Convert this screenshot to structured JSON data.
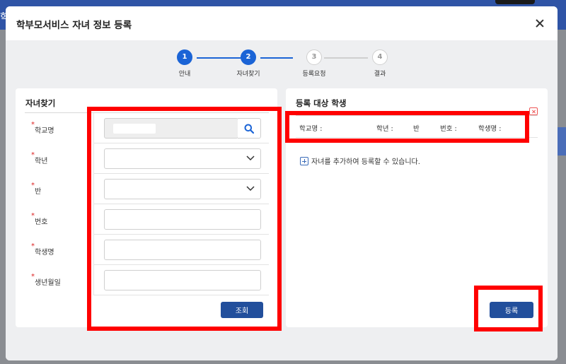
{
  "background": {
    "left_fragment": "학"
  },
  "modal": {
    "title": "학부모서비스 자녀 정보 등록",
    "close_icon": "close-icon"
  },
  "stepper": {
    "steps": [
      {
        "number": "1",
        "label": "안내",
        "active": true
      },
      {
        "number": "2",
        "label": "자녀찾기",
        "active": true
      },
      {
        "number": "3",
        "label": "등록요청",
        "active": false
      },
      {
        "number": "4",
        "label": "결과",
        "active": false
      }
    ]
  },
  "find_child": {
    "title": "자녀찾기",
    "fields": [
      {
        "label": "학교명",
        "value": "",
        "type": "search"
      },
      {
        "label": "학년",
        "value": "",
        "type": "select"
      },
      {
        "label": "반",
        "value": "",
        "type": "select"
      },
      {
        "label": "번호",
        "value": "",
        "type": "text"
      },
      {
        "label": "학생명",
        "value": "",
        "type": "text"
      },
      {
        "label": "생년월일",
        "value": "",
        "type": "text"
      }
    ],
    "required_mark": "*",
    "lookup_button": "조회"
  },
  "register_target": {
    "title": "등록 대상 학생",
    "columns": [
      "학교명 :",
      "학년 :",
      "반",
      "번호 :",
      "학생명 :"
    ],
    "add_hint": "자녀를 추가하여 등록할 수 있습니다.",
    "register_button": "등록"
  },
  "colors": {
    "primary": "#1b64d6",
    "button": "#224f9c",
    "annotation": "#ff0000"
  }
}
